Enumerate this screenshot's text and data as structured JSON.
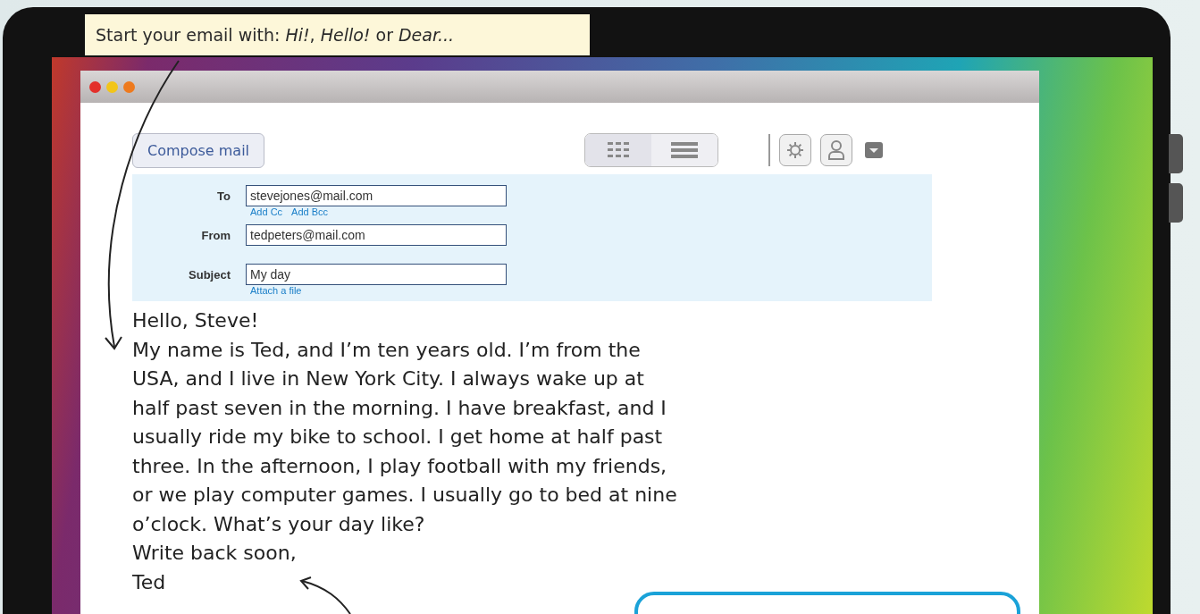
{
  "tip": {
    "text": "Start your email with: *Hi!*, *Hello!* or *Dear...*"
  },
  "toolbar": {
    "compose_button": "Compose mail"
  },
  "form": {
    "to": {
      "label": "To",
      "value": "stevejones@mail.com",
      "links": [
        "Add Cc",
        "Add Bcc"
      ]
    },
    "from": {
      "label": "From",
      "value": "tedpeters@mail.com"
    },
    "subject": {
      "label": "Subject",
      "value": "My day",
      "links": [
        "Attach a file"
      ]
    }
  },
  "letter": {
    "greeting": "Hello, Steve!",
    "body_lines": [
      "My name is Ted, and I’m ten years old. I’m from the",
      "USA, and I live in New York City. I always wake up at",
      "half past seven in the morning. I have breakfast, and I",
      "usually ride my bike to school. I get home at half past",
      "three. In the afternoon, I play football with my friends,",
      "or we play computer games. I usually go to bed at nine",
      "o’clock. What’s your day like?"
    ],
    "closing": "Write back soon,",
    "signature": "Ted"
  }
}
